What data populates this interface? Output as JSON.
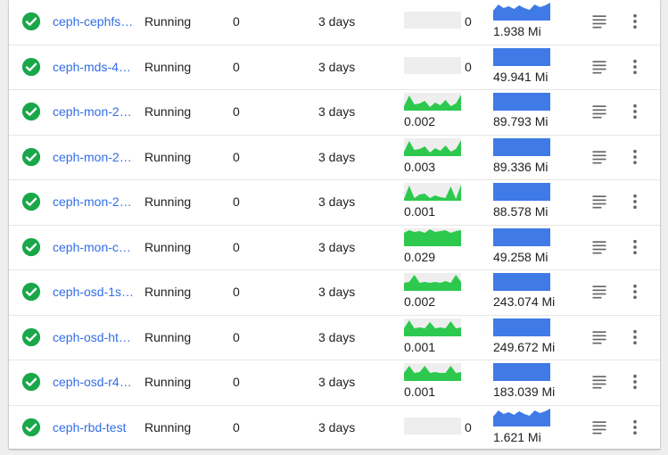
{
  "colors": {
    "status_ok": "#19a74a",
    "link": "#326de6",
    "cpu_fill": "#2dc94f",
    "mem_fill": "#3f7ae6",
    "empty": "#eeeeee",
    "icon": "#666666"
  },
  "rows": [
    {
      "name": "ceph-cephfs…",
      "status": "Running",
      "restarts": "0",
      "age": "3 days",
      "cpu": {
        "empty": true,
        "value": "0"
      },
      "mem": {
        "value": "1.938 Mi",
        "shape": "wavy"
      }
    },
    {
      "name": "ceph-mds-4…",
      "status": "Running",
      "restarts": "0",
      "age": "3 days",
      "cpu": {
        "empty": true,
        "value": "0"
      },
      "mem": {
        "value": "49.941 Mi",
        "shape": "flat"
      }
    },
    {
      "name": "ceph-mon-2…",
      "status": "Running",
      "restarts": "0",
      "age": "3 days",
      "cpu": {
        "empty": false,
        "value": "0.002",
        "shape": "peaks"
      },
      "mem": {
        "value": "89.793 Mi",
        "shape": "flat"
      }
    },
    {
      "name": "ceph-mon-2…",
      "status": "Running",
      "restarts": "0",
      "age": "3 days",
      "cpu": {
        "empty": false,
        "value": "0.003",
        "shape": "peaks"
      },
      "mem": {
        "value": "89.336 Mi",
        "shape": "flat"
      }
    },
    {
      "name": "ceph-mon-2…",
      "status": "Running",
      "restarts": "0",
      "age": "3 days",
      "cpu": {
        "empty": false,
        "value": "0.001",
        "shape": "spikes"
      },
      "mem": {
        "value": "88.578 Mi",
        "shape": "flat"
      }
    },
    {
      "name": "ceph-mon-c…",
      "status": "Running",
      "restarts": "0",
      "age": "3 days",
      "cpu": {
        "empty": false,
        "value": "0.029",
        "shape": "full"
      },
      "mem": {
        "value": "49.258 Mi",
        "shape": "flat"
      }
    },
    {
      "name": "ceph-osd-1s…",
      "status": "Running",
      "restarts": "0",
      "age": "3 days",
      "cpu": {
        "empty": false,
        "value": "0.002",
        "shape": "mid"
      },
      "mem": {
        "value": "243.074 Mi",
        "shape": "flat"
      }
    },
    {
      "name": "ceph-osd-ht…",
      "status": "Running",
      "restarts": "0",
      "age": "3 days",
      "cpu": {
        "empty": false,
        "value": "0.001",
        "shape": "low"
      },
      "mem": {
        "value": "249.672 Mi",
        "shape": "flat"
      }
    },
    {
      "name": "ceph-osd-r4…",
      "status": "Running",
      "restarts": "0",
      "age": "3 days",
      "cpu": {
        "empty": false,
        "value": "0.001",
        "shape": "low2"
      },
      "mem": {
        "value": "183.039 Mi",
        "shape": "flat"
      }
    },
    {
      "name": "ceph-rbd-test",
      "status": "Running",
      "restarts": "0",
      "age": "3 days",
      "cpu": {
        "empty": true,
        "value": "0"
      },
      "mem": {
        "value": "1.621 Mi",
        "shape": "wavy"
      }
    }
  ]
}
